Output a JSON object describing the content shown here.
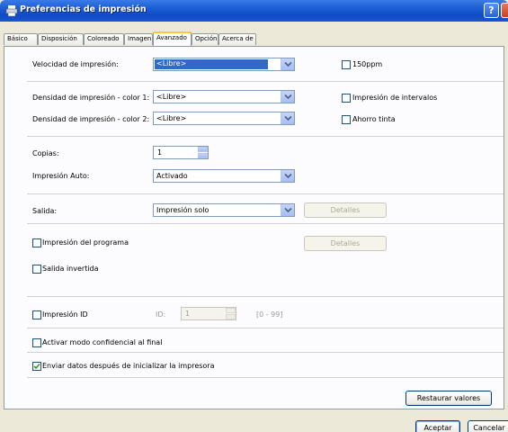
{
  "window": {
    "title": "Preferencias de impresión",
    "help": "?",
    "close": "X"
  },
  "tabs": [
    {
      "label": "Básico"
    },
    {
      "label": "Disposición"
    },
    {
      "label": "Coloreado"
    },
    {
      "label": "Imagen"
    },
    {
      "label": "Avanzado"
    },
    {
      "label": "Opción"
    },
    {
      "label": "Acerca de"
    }
  ],
  "speed": {
    "label": "Velocidad de impresión:",
    "value": "<Libre>"
  },
  "ppm150": {
    "label": "150ppm",
    "checked": false
  },
  "density1": {
    "label": "Densidad de impresión - color 1:",
    "value": "<Libre>"
  },
  "interval": {
    "label": "Impresión de intervalos",
    "checked": false
  },
  "density2": {
    "label": "Densidad de impresión - color 2:",
    "value": "<Libre>"
  },
  "ink_save": {
    "label": "Ahorro tinta",
    "checked": false
  },
  "copies": {
    "label": "Copias:",
    "value": "1"
  },
  "auto_print": {
    "label": "Impresión Auto:",
    "value": "Activado"
  },
  "output": {
    "label": "Salida:",
    "value": "Impresión solo",
    "details": "Detalles"
  },
  "program_print": {
    "label": "Impresión del programa",
    "checked": false,
    "details": "Detalles"
  },
  "inverted": {
    "label": "Salida invertida",
    "checked": false
  },
  "print_id": {
    "label": "Impresión ID",
    "checked": false,
    "id_label": "ID:",
    "id_value": "1",
    "range": "[0 - 99]"
  },
  "confidential": {
    "label": "Activar modo confidencial al final",
    "checked": false
  },
  "send_after_init": {
    "label": "Enviar datos después de inicializar la impresora",
    "checked": true
  },
  "restore": {
    "label": "Restaurar valores"
  },
  "footer": {
    "accept": "Aceptar",
    "cancel": "Cancelar"
  }
}
